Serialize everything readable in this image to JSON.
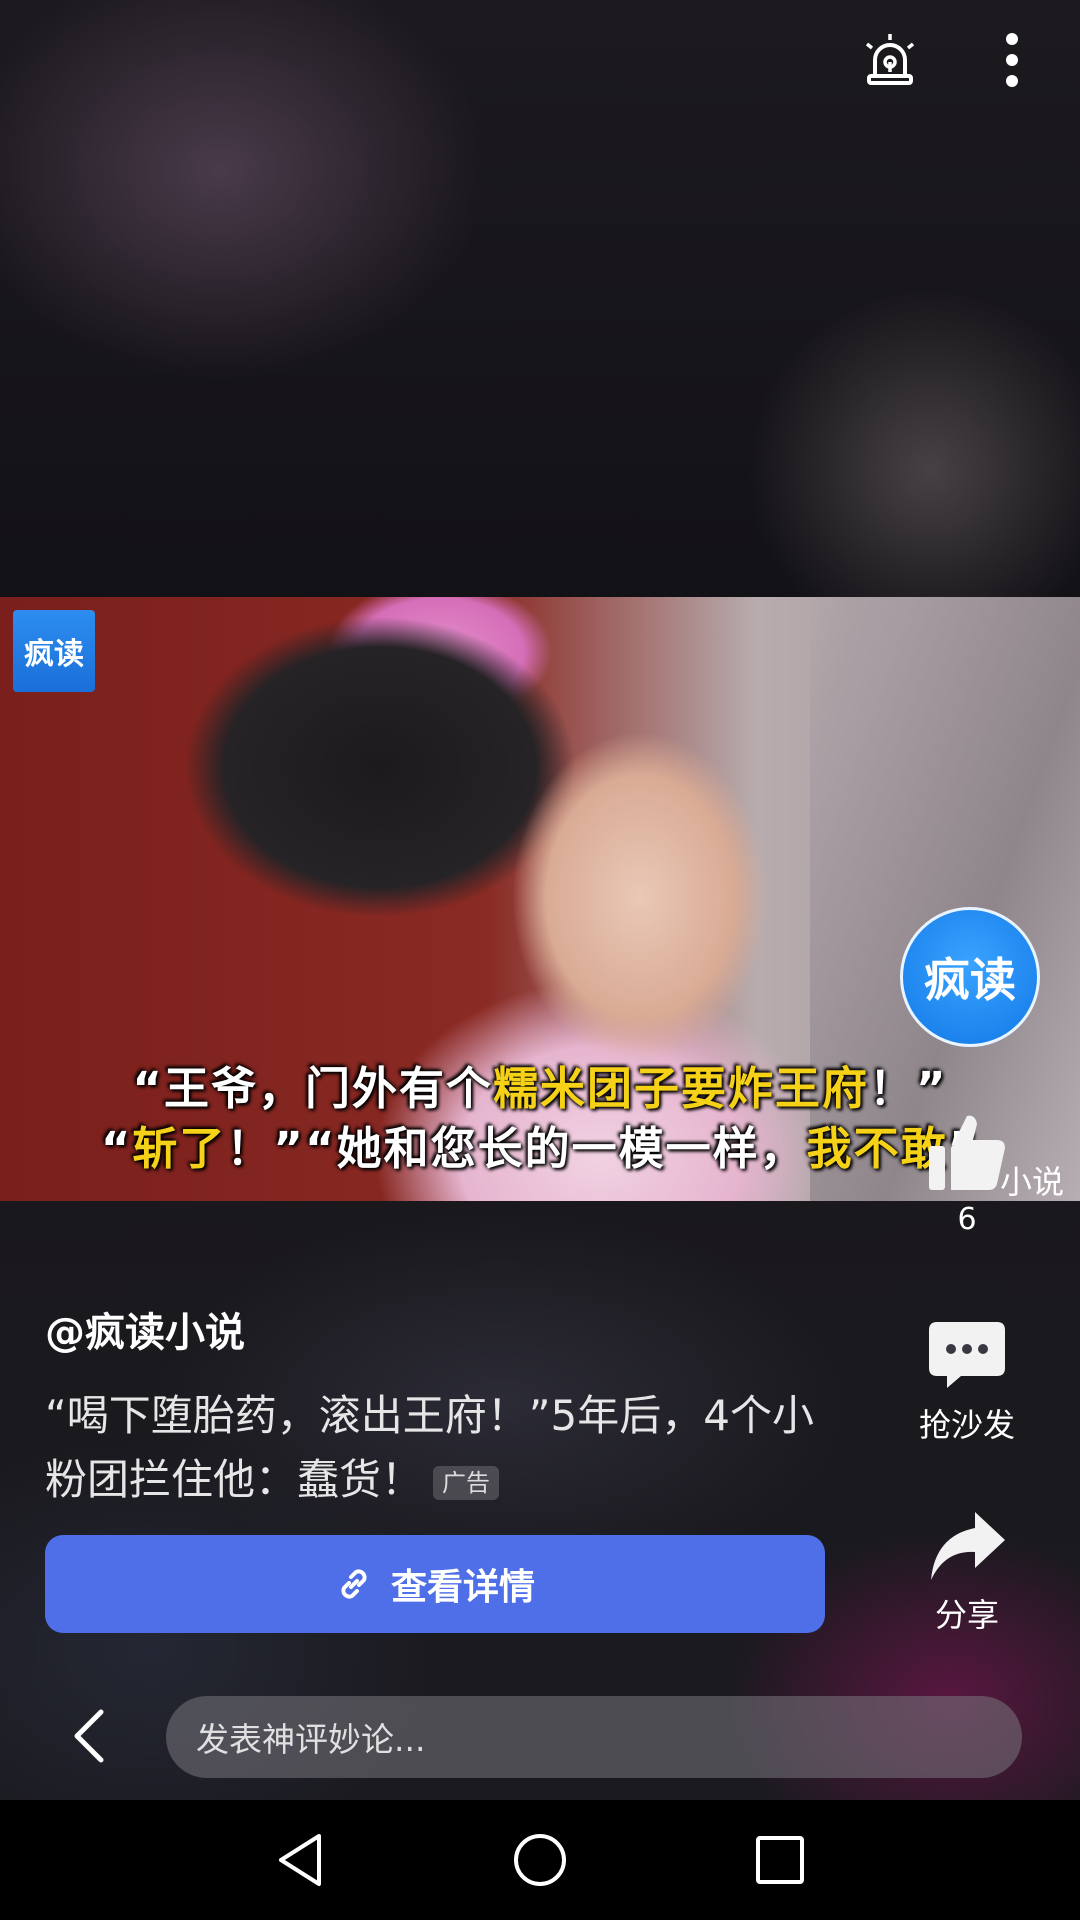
{
  "video": {
    "watermark_logo": "疯读",
    "circle_logo": "疯读",
    "subtitle_line1": {
      "part1": "“王爷，门外有个",
      "part2": "糯米团子要炸王府",
      "part3": "！”"
    },
    "subtitle_line2": {
      "part1": "“",
      "part2": "斩了",
      "part3": "！”“她和您长的一模一样，",
      "part4": "我不敢",
      "part5": "”"
    }
  },
  "actions": {
    "like_count": "6",
    "like_side_text": "小说",
    "comment_label": "抢沙发",
    "share_label": "分享"
  },
  "post": {
    "author": "@疯读小说",
    "description": "“喝下堕胎药，滚出王府！”5年后，4个小粉团拦住他：蠢货！",
    "ad_badge": "广告",
    "cta_label": "查看详情"
  },
  "comment_bar": {
    "placeholder": "发表神评妙论..."
  },
  "icons": {
    "alarm": "alarm-icon",
    "more": "more-vertical-icon",
    "like": "thumbs-up-icon",
    "comment": "comment-bubble-icon",
    "share": "share-arrow-icon",
    "link": "link-icon",
    "back": "chevron-left-icon"
  },
  "colors": {
    "cta": "#4f6fe9",
    "subtitle_highlight": "#f5d218",
    "logo_blue": "#1a6fd8"
  }
}
